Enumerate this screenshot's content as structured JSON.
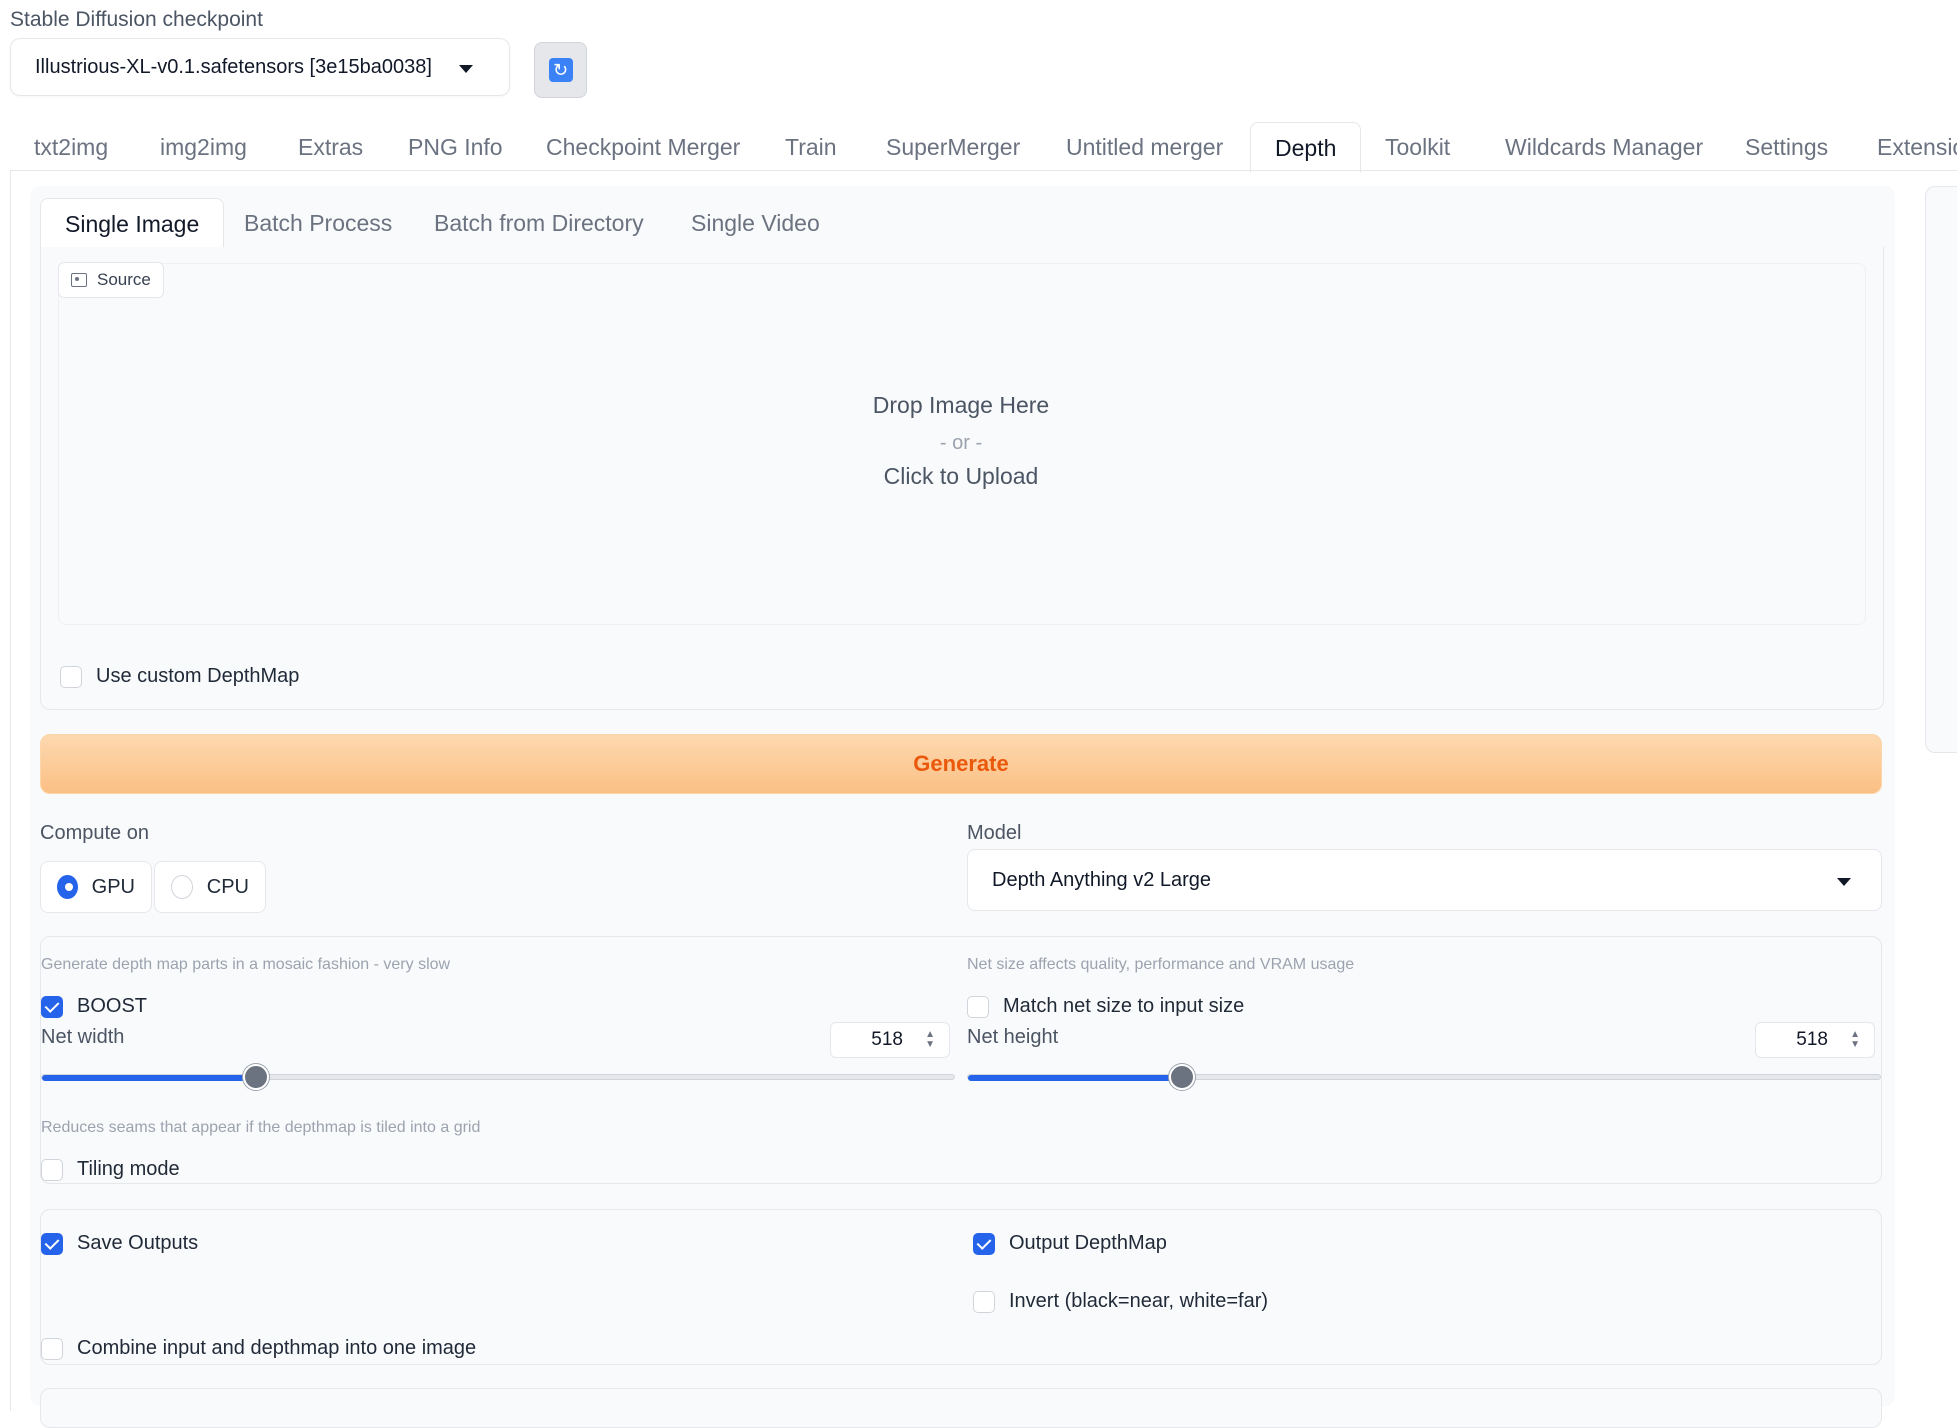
{
  "checkpoint": {
    "label": "Stable Diffusion checkpoint",
    "value": "Illustrious-XL-v0.1.safetensors [3e15ba0038]",
    "refresh_icon": "refresh-icon"
  },
  "tabs": [
    {
      "label": "txt2img"
    },
    {
      "label": "img2img"
    },
    {
      "label": "Extras"
    },
    {
      "label": "PNG Info"
    },
    {
      "label": "Checkpoint Merger"
    },
    {
      "label": "Train"
    },
    {
      "label": "SuperMerger"
    },
    {
      "label": "Untitled merger"
    },
    {
      "label": "Depth"
    },
    {
      "label": "Toolkit"
    },
    {
      "label": "Wildcards Manager"
    },
    {
      "label": "Settings"
    },
    {
      "label": "Extensio"
    }
  ],
  "active_tab": "Depth",
  "subtabs": [
    {
      "label": "Single Image"
    },
    {
      "label": "Batch Process"
    },
    {
      "label": "Batch from Directory"
    },
    {
      "label": "Single Video"
    }
  ],
  "source": {
    "tag": "Source",
    "drop_line1": "Drop Image Here",
    "drop_line2": "- or -",
    "drop_line3": "Click to Upload"
  },
  "custom_depthmap": {
    "label": "Use custom DepthMap",
    "checked": false
  },
  "generate_label": "Generate",
  "compute": {
    "label": "Compute on",
    "options": [
      {
        "label": "GPU",
        "selected": true
      },
      {
        "label": "CPU",
        "selected": false
      }
    ]
  },
  "model": {
    "label": "Model",
    "value": "Depth Anything v2 Large"
  },
  "boost": {
    "info": "Generate depth map parts in a mosaic fashion - very slow",
    "label": "BOOST",
    "checked": true
  },
  "match_net": {
    "info": "Net size affects quality, performance and VRAM usage",
    "label": "Match net size to input size",
    "checked": false
  },
  "net_width": {
    "label": "Net width",
    "value": "518",
    "fraction": 0.235
  },
  "net_height": {
    "label": "Net height",
    "value": "518",
    "fraction": 0.235
  },
  "tiling": {
    "info": "Reduces seams that appear if the depthmap is tiled into a grid",
    "label": "Tiling mode",
    "checked": false
  },
  "outputs": {
    "save": {
      "label": "Save Outputs",
      "checked": true
    },
    "output_depthmap": {
      "label": "Output DepthMap",
      "checked": true
    },
    "invert": {
      "label": "Invert (black=near, white=far)",
      "checked": false
    },
    "combine": {
      "label": "Combine input and depthmap into one image",
      "checked": false
    }
  },
  "colors": {
    "accent": "#2563eb",
    "generate_text": "#ea580c"
  }
}
